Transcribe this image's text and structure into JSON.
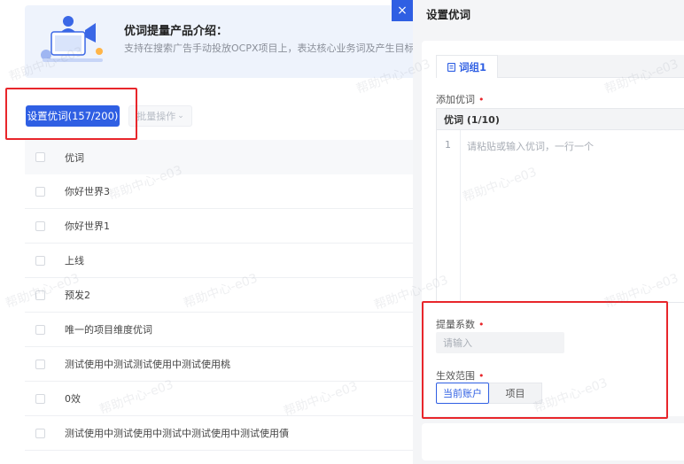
{
  "intro": {
    "title": "优词提量产品介绍：",
    "description": "支持在搜索广告手动投放OCPX项目上，表达核心业务词及产生目标转化之后..."
  },
  "toolbar": {
    "set_button_label": "设置优词(157/200)",
    "batch_button_label": "批量操作",
    "batch_chevron_icon": "chevron-down-icon"
  },
  "table": {
    "header": "优词",
    "rows": [
      "你好世界3",
      "你好世界1",
      "上线",
      "预发2",
      "唯一的项目维度优词",
      "测试使用中测试测试使用中测试使用桃",
      "0效",
      "测试使用中测试使用中测试中测试使用中测试使用債"
    ]
  },
  "drawer": {
    "close_icon": "×",
    "title": "设置优词",
    "tab_label": "词组1",
    "tab_icon": "document-icon",
    "add_words_label": "添加优词",
    "editor_header": "优词 (1/10)",
    "editor_line_number": "1",
    "editor_placeholder": "请粘贴或输入优词，一行一个",
    "coefficient_label": "提量系数",
    "coefficient_placeholder": "请输入",
    "scope_label": "生效范围",
    "scope_options": [
      "当前账户",
      "项目"
    ],
    "scope_selected": "当前账户",
    "required_mark": "•"
  },
  "watermark": "帮助中心-e03",
  "colors": {
    "primary": "#2f5fe3",
    "highlight_box": "#e8262b",
    "required": "#e8262b"
  }
}
